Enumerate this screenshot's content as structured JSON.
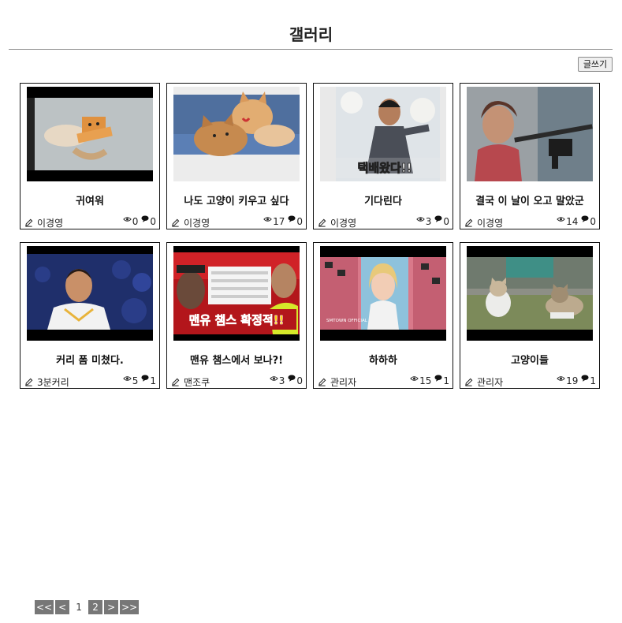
{
  "page": {
    "title": "갤러리",
    "write_button": "글쓰기"
  },
  "posts": [
    {
      "title": "귀여워",
      "author": "이경영",
      "views": "0",
      "comments": "0",
      "thumb": "dog-with-box-mask-icon"
    },
    {
      "title": "나도 고양이 키우고 싶다",
      "author": "이경영",
      "views": "17",
      "comments": "0",
      "thumb": "kittens-icon"
    },
    {
      "title": "기다린다",
      "author": "이경영",
      "views": "3",
      "comments": "0",
      "thumb": "delivery-man-icon",
      "thumb_caption": "택배왔다!!"
    },
    {
      "title": "결국 이 날이 오고 말았군",
      "author": "이경영",
      "views": "14",
      "comments": "0",
      "thumb": "grandma-with-gun-icon"
    },
    {
      "title": "커리 폼 미쳤다.",
      "author": "3분커리",
      "views": "5",
      "comments": "1",
      "thumb": "basketball-player-icon"
    },
    {
      "title": "맨유 챔스에서 보나?!",
      "author": "맨조쿠",
      "views": "3",
      "comments": "0",
      "thumb": "football-thumbnail-icon",
      "thumb_caption": "맨유 챔스 확정적!!"
    },
    {
      "title": "하하하",
      "author": "관리자",
      "views": "15",
      "comments": "1",
      "thumb": "music-video-still-icon",
      "thumb_caption": "SMTOWN OFFICIAL"
    },
    {
      "title": "고양이들",
      "author": "관리자",
      "views": "19",
      "comments": "1",
      "thumb": "two-cats-icon"
    }
  ],
  "pagination": {
    "first": "<<",
    "prev": "<",
    "pages": [
      "1",
      "2"
    ],
    "current": "1",
    "next": ">",
    "last": ">>"
  },
  "colors": {
    "pager_button": "#777777",
    "card_border": "#111111",
    "rule": "#8a8a8a"
  }
}
